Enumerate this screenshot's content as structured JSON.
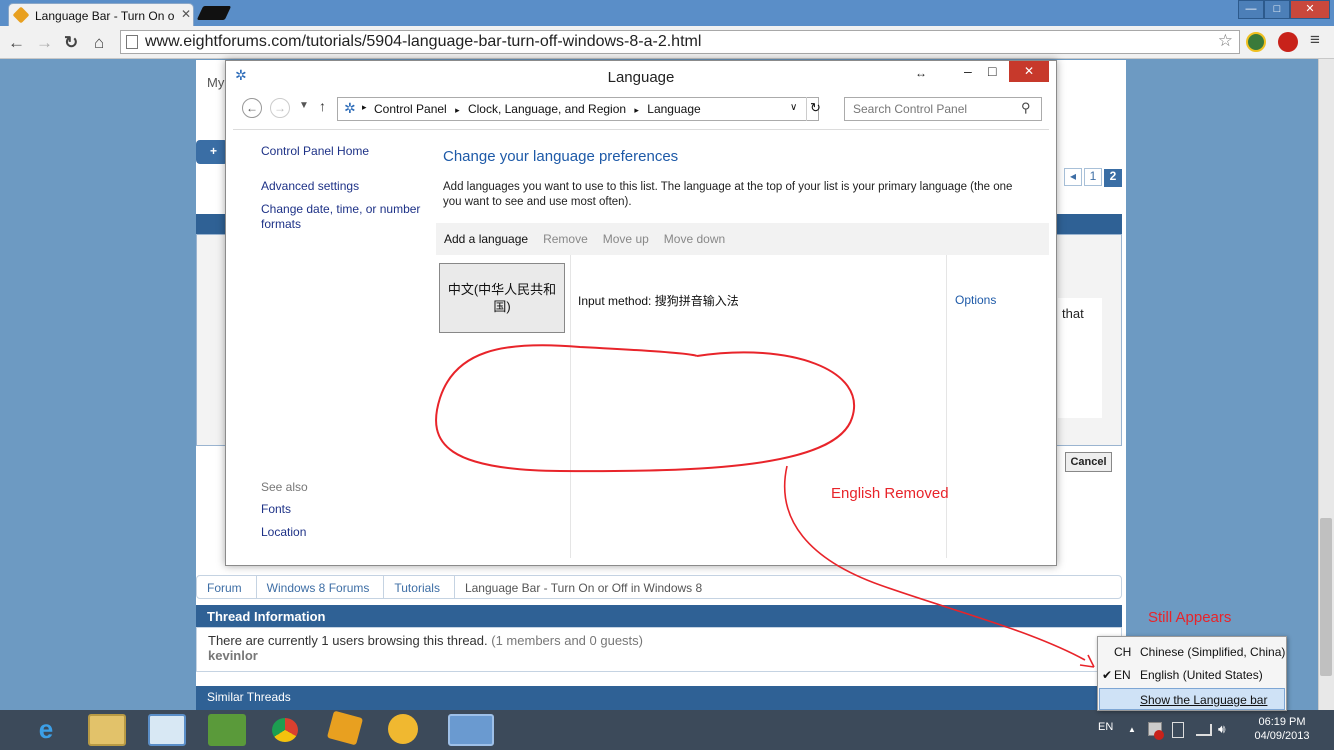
{
  "browser": {
    "tab_title": "Language Bar - Turn On o",
    "url": "www.eightforums.com/tutorials/5904-language-bar-turn-off-windows-8-a-2.html",
    "win_min": "—",
    "win_max": "□",
    "win_close": "✕"
  },
  "page": {
    "my_label": "My",
    "pagination": [
      "1",
      "2"
    ],
    "cancel_label": "Cancel",
    "editor_text": "that",
    "breadcrumb": [
      "Forum",
      "Windows 8 Forums",
      "Tutorials",
      "Language Bar - Turn On or Off in Windows 8"
    ],
    "thread_info": {
      "title": "Thread Information",
      "text": "There are currently 1 users browsing this thread.",
      "guests": "(1 members and 0 guests)",
      "user": "kevinlor"
    },
    "similar_threads": "Similar Threads"
  },
  "control_panel": {
    "window_title": "Language",
    "address": [
      "Control Panel",
      "Clock, Language, and Region",
      "Language"
    ],
    "search_placeholder": "Search Control Panel",
    "sidebar": {
      "home": "Control Panel Home",
      "advanced": "Advanced settings",
      "change_date": "Change date, time, or number formats",
      "see_also": "See also",
      "fonts": "Fonts",
      "location": "Location"
    },
    "heading": "Change your language preferences",
    "description": "Add languages you want to use to this list. The language at the top of your list is your primary language (the one you want to see and use most often).",
    "commands": [
      "Add a language",
      "Remove",
      "Move up",
      "Move down"
    ],
    "language": {
      "name": "中文(中华人民共和国)",
      "input_method": "Input method: 搜狗拼音输入法",
      "options": "Options"
    }
  },
  "annotations": {
    "english_removed": "English Removed",
    "still_appears": "Still Appears",
    "ring_color": "#e8242a"
  },
  "language_menu": {
    "items": [
      {
        "code": "CH",
        "label": "Chinese (Simplified, China)",
        "checked": ""
      },
      {
        "code": "EN",
        "label": "English (United States)",
        "checked": "✔"
      }
    ],
    "show_bar": "Show the Language bar"
  },
  "taskbar": {
    "lang_indicator": "EN",
    "time": "06:19 PM",
    "date": "04/09/2013",
    "up_arrow": "▲"
  }
}
